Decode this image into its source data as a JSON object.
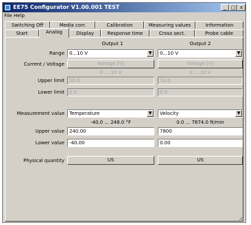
{
  "window": {
    "title": "EE75 Configurator V1.00.001 TEST",
    "minimize": "_",
    "maximize": "□",
    "close": "x"
  },
  "menu": {
    "file": "File",
    "help": "Help"
  },
  "tabs_row1": [
    "Switching Off",
    "Media corr.",
    "Calibration",
    "Measuring values",
    "Information"
  ],
  "tabs_row2": [
    "Start",
    "Analog",
    "Display",
    "Response time",
    "Cross sect.",
    "Probe cable"
  ],
  "active_tab": "Analog",
  "analog": {
    "output1_header": "Output 1",
    "output2_header": "Output 2",
    "range_label": "Range",
    "range1_value": "0...10 V",
    "range2_value": "0...10 V",
    "current_voltage_label": "Current / Voltage",
    "cv1_button": "Voltage [V]",
    "cv2_button": "Voltage [V]",
    "cv1_range": "0 ... 10 V",
    "cv2_range": "0 ... 10 V",
    "upper_limit_label": "Upper limit",
    "lower_limit_label": "Lower limit",
    "upper_limit1": "10.0",
    "upper_limit2": "10.0",
    "lower_limit1": "0.0",
    "lower_limit2": "0.0",
    "measurement_value_label": "Measurement value",
    "mv1_value": "Temperature",
    "mv2_value": "Velocity",
    "mv1_range": "-40.0 ... 248.0 °F",
    "mv2_range": "0.0 ... 7874.0 ft/min",
    "upper_value_label": "Upper value",
    "lower_value_label": "Lower value",
    "upper_value1": "240.00",
    "upper_value2": "7800",
    "lower_value1": "-40.00",
    "lower_value2": "0.00",
    "physical_quantity_label": "Physical quantity",
    "pq1_button": "US",
    "pq2_button": "US"
  },
  "colors": {
    "titlebar_start": "#0a246a",
    "titlebar_end": "#a6caf0",
    "face": "#d4d0c8"
  }
}
